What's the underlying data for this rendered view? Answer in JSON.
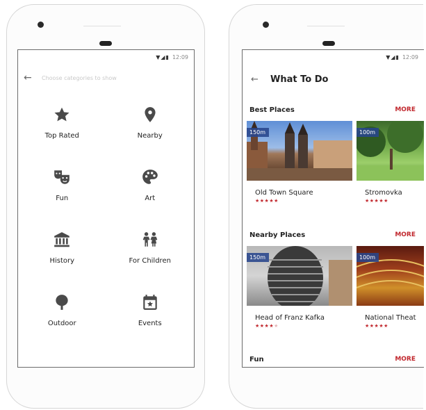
{
  "left_screen": {
    "status_time": "12:09",
    "status_icons": "▼◢▮",
    "back_icon": "arrow-left-icon",
    "search_placeholder": "Choose categories to show",
    "categories": [
      {
        "label": "Top Rated",
        "icon": "star-icon"
      },
      {
        "label": "Nearby",
        "icon": "map-pin-icon"
      },
      {
        "label": "Fun",
        "icon": "theater-masks-icon"
      },
      {
        "label": "Art",
        "icon": "palette-icon"
      },
      {
        "label": "History",
        "icon": "museum-icon"
      },
      {
        "label": "For Children",
        "icon": "children-icon"
      },
      {
        "label": "Outdoor",
        "icon": "tree-icon"
      },
      {
        "label": "Events",
        "icon": "calendar-star-icon"
      }
    ]
  },
  "right_screen": {
    "status_time": "12:09",
    "status_icons": "▼◢▮",
    "back_icon": "arrow-left-icon",
    "title": "What To Do",
    "sections": [
      {
        "title": "Best Places",
        "more_label": "MORE",
        "cards": [
          {
            "name": "Old Town Square",
            "distance": "150m",
            "stars": "★★★★★",
            "stars_dim": ""
          },
          {
            "name": "Stromovka",
            "distance": "100m",
            "stars": "★★★★★",
            "stars_dim": ""
          }
        ]
      },
      {
        "title": "Nearby Places",
        "more_label": "MORE",
        "cards": [
          {
            "name": "Head of Franz Kafka",
            "distance": "150m",
            "stars": "★★★★",
            "stars_dim": "★"
          },
          {
            "name": "National Theat",
            "distance": "100m",
            "stars": "★★★★★",
            "stars_dim": ""
          }
        ]
      },
      {
        "title": "Fun",
        "more_label": "MORE",
        "cards": []
      }
    ]
  },
  "colors": {
    "accent": "#c1272d",
    "badge": "#28468c",
    "icon": "#4a4a4a"
  }
}
